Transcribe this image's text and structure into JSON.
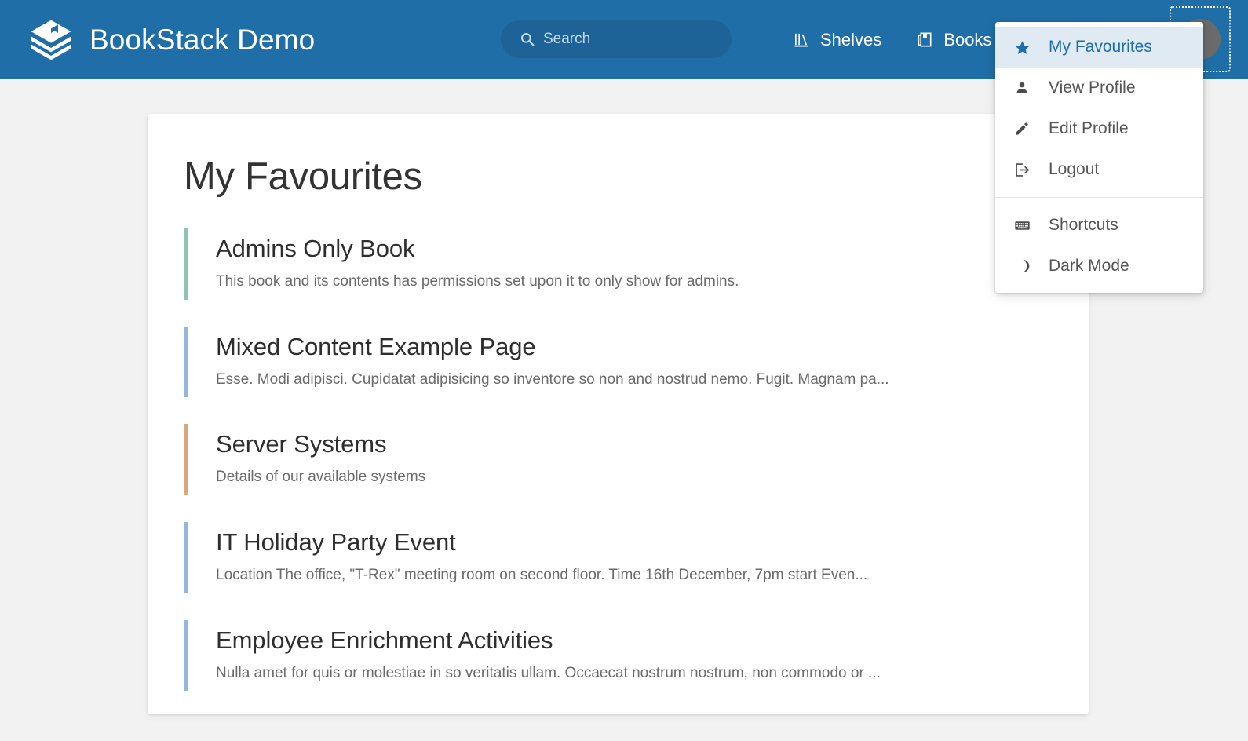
{
  "header": {
    "brand_name": "BookStack Demo",
    "logo_icon": "bookstack-logo",
    "search": {
      "placeholder": "Search",
      "value": "",
      "icon": "search-icon"
    },
    "nav": [
      {
        "label": "Shelves",
        "icon": "shelves-icon"
      },
      {
        "label": "Books",
        "icon": "books-icon"
      }
    ],
    "avatar": {
      "icon": "user-avatar"
    },
    "background_color": "#206ea7"
  },
  "user_dropdown": {
    "groups": [
      {
        "items": [
          {
            "label": "My Favourites",
            "icon": "star-icon",
            "active": true
          },
          {
            "label": "View Profile",
            "icon": "person-icon",
            "active": false
          },
          {
            "label": "Edit Profile",
            "icon": "pencil-icon",
            "active": false
          },
          {
            "label": "Logout",
            "icon": "logout-icon",
            "active": false
          }
        ]
      },
      {
        "items": [
          {
            "label": "Shortcuts",
            "icon": "keyboard-icon",
            "active": false
          },
          {
            "label": "Dark Mode",
            "icon": "moon-icon",
            "active": false
          }
        ]
      }
    ],
    "active_color": "#206ea7",
    "active_background": "#dfeaf3"
  },
  "main": {
    "page_title": "My Favourites",
    "entries": [
      {
        "title": "Admins Only Book",
        "description": "This book and its contents has permissions set upon it to only show for admins.",
        "accent_color": "#8ec4b0"
      },
      {
        "title": "Mixed Content Example Page",
        "description": "Esse. Modi adipisci. Cupidatat adipisicing so inventore so non and nostrud nemo. Fugit. Magnam pa...",
        "accent_color": "#93b8db"
      },
      {
        "title": "Server Systems",
        "description": "Details of our available systems",
        "accent_color": "#dca67d"
      },
      {
        "title": "IT Holiday Party Event",
        "description": "Location The office, \"T-Rex\" meeting room on second floor. Time 16th December, 7pm start Even...",
        "accent_color": "#93b8db"
      },
      {
        "title": "Employee Enrichment Activities",
        "description": "Nulla amet for quis or molestiae in so veritatis ullam. Occaecat nostrum nostrum, non commodo or ...",
        "accent_color": "#93b8db"
      }
    ]
  }
}
